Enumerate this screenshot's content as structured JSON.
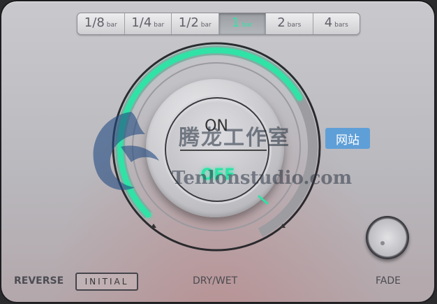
{
  "sync_selector": {
    "options": [
      {
        "num": "1/8",
        "unit": "bar"
      },
      {
        "num": "1/4",
        "unit": "bar"
      },
      {
        "num": "1/2",
        "unit": "bar"
      },
      {
        "num": "1",
        "unit": "bar"
      },
      {
        "num": "2",
        "unit": "bars"
      },
      {
        "num": "4",
        "unit": "bars"
      }
    ],
    "selected": "1 bar"
  },
  "main_knob": {
    "on_label": "ON",
    "off_label": "OFF",
    "state": "OFF",
    "accent_color": "#2fe3a6",
    "dry_wet_level": 0.72
  },
  "bottom_bar": {
    "reverse_label": "REVERSE",
    "initial_label": "INITIAL",
    "dry_wet_label": "DRY/WET",
    "fade_label": "FADE"
  },
  "fade_knob": {
    "level": 0.1
  },
  "watermark": {
    "title": "腾龙工作室",
    "badge": "网站",
    "url": "Tenlonstudio.com",
    "logo_icon": "dragon-logo-icon"
  }
}
